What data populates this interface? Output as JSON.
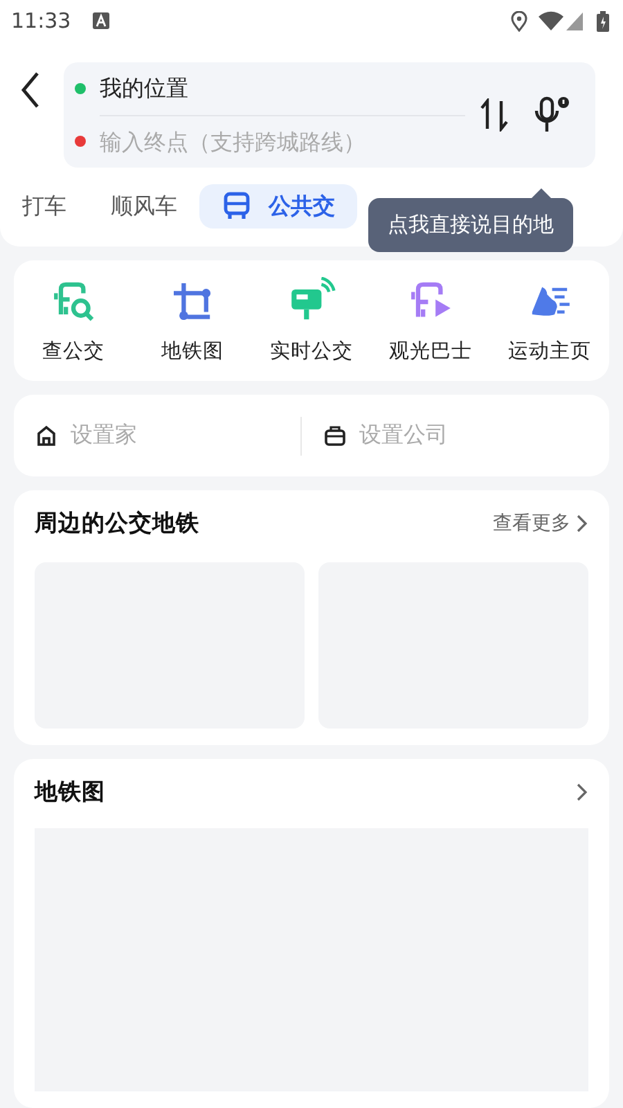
{
  "status_bar": {
    "time": "11:33"
  },
  "route": {
    "origin": "我的位置",
    "destination": {
      "placeholder": "输入终点（支持跨城路线）"
    }
  },
  "tooltip": "点我直接说目的地",
  "tabs": [
    {
      "label": "打车",
      "selected": false
    },
    {
      "label": "顺风车",
      "selected": false
    },
    {
      "label": "公共交",
      "selected": true
    }
  ],
  "shortcuts": [
    {
      "label": "查公交",
      "color": "#2ec28f"
    },
    {
      "label": "地铁图",
      "color": "#4f74e0"
    },
    {
      "label": "实时公交",
      "color": "#22c88e"
    },
    {
      "label": "观光巴士",
      "color": "#a57cf5"
    },
    {
      "label": "运动主页",
      "color": "#4f7ae8"
    }
  ],
  "places": [
    {
      "label": "设置家"
    },
    {
      "label": "设置公司"
    }
  ],
  "nearby": {
    "title": "周边的公交地铁",
    "more": "查看更多"
  },
  "subway": {
    "title": "地铁图"
  }
}
